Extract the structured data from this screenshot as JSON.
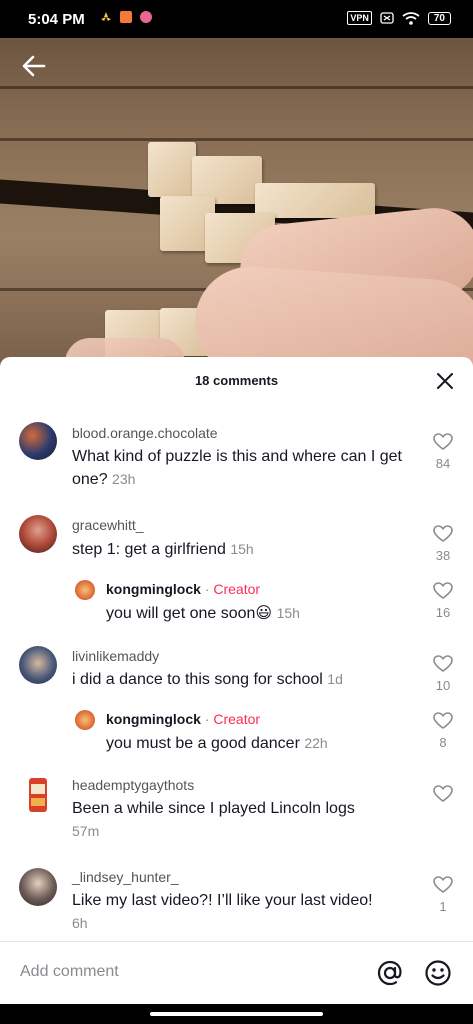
{
  "status": {
    "time": "5:04 PM",
    "vpn": "VPN",
    "battery": "70"
  },
  "sheet": {
    "title": "18 comments"
  },
  "comments": [
    {
      "user": "blood.orange.chocolate",
      "text": "What kind of puzzle is this and where can I get one?",
      "time": "23h",
      "likes": "84",
      "avatar_color": "#2b3a6e"
    },
    {
      "user": "gracewhitt_",
      "text": "step 1: get a girlfriend",
      "time": "15h",
      "likes": "38",
      "avatar_color": "#b04a3a"
    },
    {
      "user": "kongminglock",
      "creator_label": "Creator",
      "text": "you will get one soon😃",
      "time": "15h",
      "likes": "16",
      "avatar_color": "#e0703a"
    },
    {
      "user": "livinlikemaddy",
      "text": "i did a dance to this song for school",
      "time": "1d",
      "likes": "10",
      "avatar_color": "#4a5a7a"
    },
    {
      "user": "kongminglock",
      "creator_label": "Creator",
      "text": "you must be a good dancer",
      "time": "22h",
      "likes": "8",
      "avatar_color": "#e0703a"
    },
    {
      "user": "heademptygaythots",
      "text": "Been a while since I played Lincoln logs",
      "time": "57m",
      "likes": "",
      "avatar_color": "#d8402a"
    },
    {
      "user": "_lindsey_hunter_",
      "text": "Like my last video?! I’ll like your last video!",
      "time": "6h",
      "likes": "1",
      "avatar_color": "#6a5a55"
    }
  ],
  "input": {
    "placeholder": "Add comment"
  },
  "icons": {
    "back": "back-arrow-icon",
    "close": "close-icon",
    "like": "heart-outline-icon",
    "mention": "at-sign-icon",
    "emoji": "smiley-icon"
  },
  "colors": {
    "creator": "#fe2c55",
    "secondary_text": "#8a8b91"
  }
}
